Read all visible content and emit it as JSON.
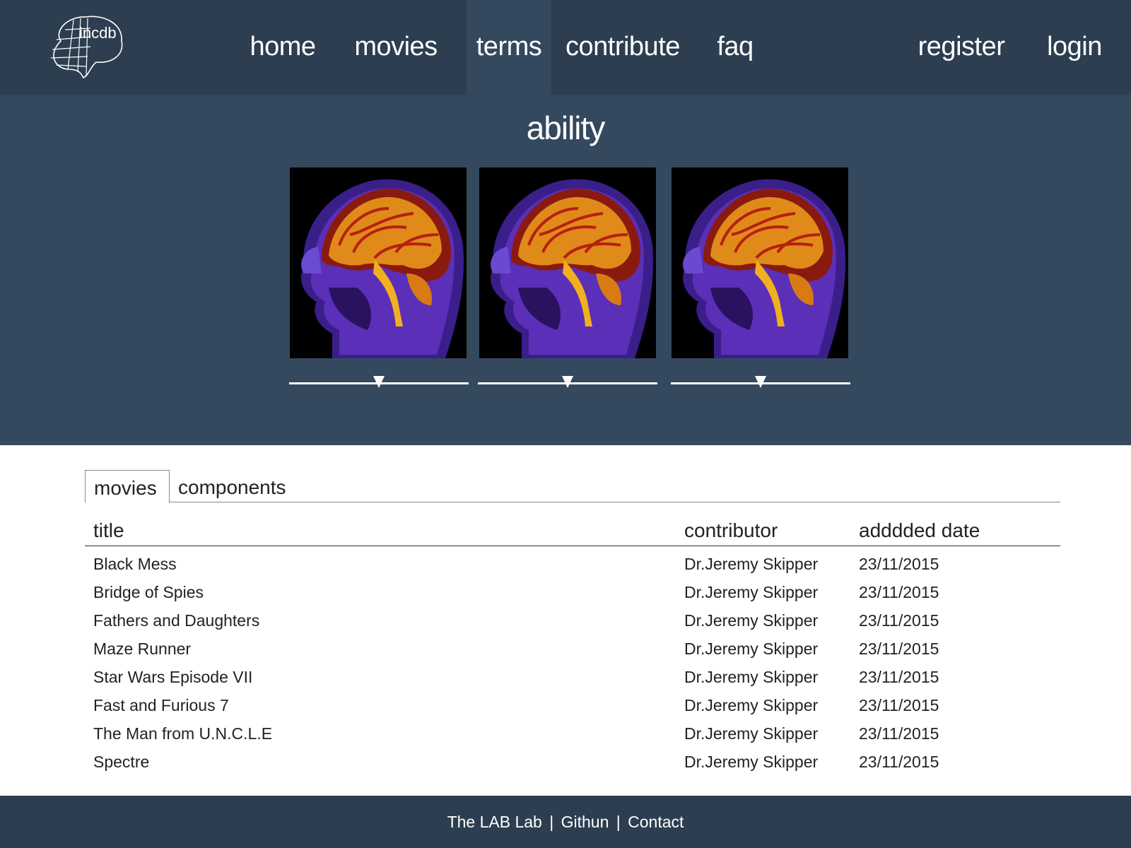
{
  "brand": {
    "logo_text": "incdb"
  },
  "nav": {
    "home": "home",
    "movies": "movies",
    "terms": "terms",
    "contribute": "contribute",
    "faq": "faq",
    "register": "register",
    "login": "login",
    "active": "terms"
  },
  "hero": {
    "title": "ability",
    "images": [
      {
        "icon": "brain-mri-image",
        "slider_value": 0.5
      },
      {
        "icon": "brain-mri-image",
        "slider_value": 0.5
      },
      {
        "icon": "brain-mri-image",
        "slider_value": 0.5
      }
    ]
  },
  "tabs": {
    "movies": "movies",
    "components": "components",
    "active": "movies"
  },
  "table": {
    "headers": {
      "title": "title",
      "contributor": "contributor",
      "date": "adddded date"
    },
    "rows": [
      {
        "title": "Black Mess",
        "contributor": "Dr.Jeremy Skipper",
        "date": "23/11/2015"
      },
      {
        "title": "Bridge of Spies",
        "contributor": "Dr.Jeremy Skipper",
        "date": "23/11/2015"
      },
      {
        "title": "Fathers and Daughters",
        "contributor": "Dr.Jeremy Skipper",
        "date": "23/11/2015"
      },
      {
        "title": "Maze Runner",
        "contributor": "Dr.Jeremy Skipper",
        "date": "23/11/2015"
      },
      {
        "title": "Star Wars Episode VII",
        "contributor": "Dr.Jeremy Skipper",
        "date": "23/11/2015"
      },
      {
        "title": "Fast and Furious 7",
        "contributor": "Dr.Jeremy Skipper",
        "date": "23/11/2015"
      },
      {
        "title": "The Man from U.N.C.L.E",
        "contributor": "Dr.Jeremy Skipper",
        "date": "23/11/2015"
      },
      {
        "title": "Spectre",
        "contributor": "Dr.Jeremy Skipper",
        "date": "23/11/2015"
      }
    ]
  },
  "footer": {
    "lab": "The LAB Lab",
    "github": "Githun",
    "contact": "Contact",
    "separator": "|"
  },
  "colors": {
    "navbar": "#2c3e50",
    "hero": "#34495e",
    "active_nav": "#34495e",
    "text_dark": "#222222"
  }
}
